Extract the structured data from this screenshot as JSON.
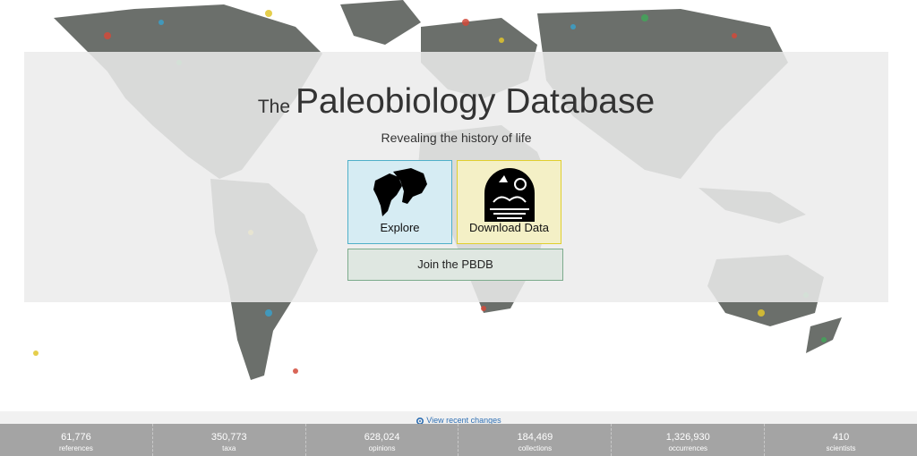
{
  "hero": {
    "title_small": "The",
    "title_large": "Paleobiology Database",
    "tagline": "Revealing the history of life"
  },
  "tiles": {
    "explore_label": "Explore",
    "download_label": "Download Data",
    "join_label": "Join the PBDB"
  },
  "recent": {
    "link_text": "View recent changes",
    "icon": "gear-icon"
  },
  "stats": [
    {
      "value": "61,776",
      "label": "references"
    },
    {
      "value": "350,773",
      "label": "taxa"
    },
    {
      "value": "628,024",
      "label": "opinions"
    },
    {
      "value": "184,469",
      "label": "collections"
    },
    {
      "value": "1,326,930",
      "label": "occurrences"
    },
    {
      "value": "410",
      "label": "scientists"
    }
  ],
  "colors": {
    "explore_bg": "#d6ecf3",
    "explore_border": "#4fb0c9",
    "download_bg": "#f4f0c6",
    "download_border": "#e0cf2e",
    "join_bg": "#dfe7e1",
    "join_border": "#7cab8c",
    "stats_bar": "#a4a4a4",
    "link": "#2e6fb3"
  }
}
